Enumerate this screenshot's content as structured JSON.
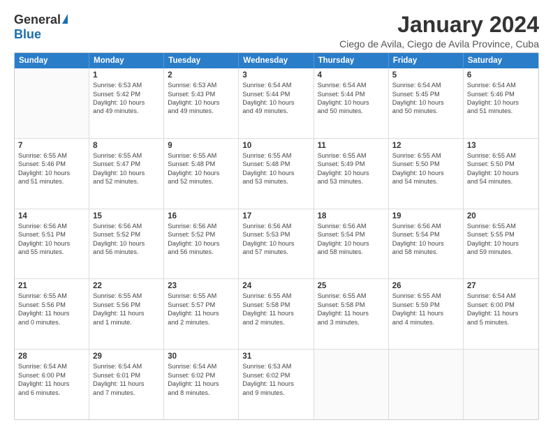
{
  "logo": {
    "general": "General",
    "blue": "Blue"
  },
  "title": "January 2024",
  "subtitle": "Ciego de Avila, Ciego de Avila Province, Cuba",
  "header_days": [
    "Sunday",
    "Monday",
    "Tuesday",
    "Wednesday",
    "Thursday",
    "Friday",
    "Saturday"
  ],
  "weeks": [
    [
      {
        "day": "",
        "info": ""
      },
      {
        "day": "1",
        "info": "Sunrise: 6:53 AM\nSunset: 5:42 PM\nDaylight: 10 hours\nand 49 minutes."
      },
      {
        "day": "2",
        "info": "Sunrise: 6:53 AM\nSunset: 5:43 PM\nDaylight: 10 hours\nand 49 minutes."
      },
      {
        "day": "3",
        "info": "Sunrise: 6:54 AM\nSunset: 5:44 PM\nDaylight: 10 hours\nand 49 minutes."
      },
      {
        "day": "4",
        "info": "Sunrise: 6:54 AM\nSunset: 5:44 PM\nDaylight: 10 hours\nand 50 minutes."
      },
      {
        "day": "5",
        "info": "Sunrise: 6:54 AM\nSunset: 5:45 PM\nDaylight: 10 hours\nand 50 minutes."
      },
      {
        "day": "6",
        "info": "Sunrise: 6:54 AM\nSunset: 5:46 PM\nDaylight: 10 hours\nand 51 minutes."
      }
    ],
    [
      {
        "day": "7",
        "info": "Sunrise: 6:55 AM\nSunset: 5:46 PM\nDaylight: 10 hours\nand 51 minutes."
      },
      {
        "day": "8",
        "info": "Sunrise: 6:55 AM\nSunset: 5:47 PM\nDaylight: 10 hours\nand 52 minutes."
      },
      {
        "day": "9",
        "info": "Sunrise: 6:55 AM\nSunset: 5:48 PM\nDaylight: 10 hours\nand 52 minutes."
      },
      {
        "day": "10",
        "info": "Sunrise: 6:55 AM\nSunset: 5:48 PM\nDaylight: 10 hours\nand 53 minutes."
      },
      {
        "day": "11",
        "info": "Sunrise: 6:55 AM\nSunset: 5:49 PM\nDaylight: 10 hours\nand 53 minutes."
      },
      {
        "day": "12",
        "info": "Sunrise: 6:55 AM\nSunset: 5:50 PM\nDaylight: 10 hours\nand 54 minutes."
      },
      {
        "day": "13",
        "info": "Sunrise: 6:55 AM\nSunset: 5:50 PM\nDaylight: 10 hours\nand 54 minutes."
      }
    ],
    [
      {
        "day": "14",
        "info": "Sunrise: 6:56 AM\nSunset: 5:51 PM\nDaylight: 10 hours\nand 55 minutes."
      },
      {
        "day": "15",
        "info": "Sunrise: 6:56 AM\nSunset: 5:52 PM\nDaylight: 10 hours\nand 56 minutes."
      },
      {
        "day": "16",
        "info": "Sunrise: 6:56 AM\nSunset: 5:52 PM\nDaylight: 10 hours\nand 56 minutes."
      },
      {
        "day": "17",
        "info": "Sunrise: 6:56 AM\nSunset: 5:53 PM\nDaylight: 10 hours\nand 57 minutes."
      },
      {
        "day": "18",
        "info": "Sunrise: 6:56 AM\nSunset: 5:54 PM\nDaylight: 10 hours\nand 58 minutes."
      },
      {
        "day": "19",
        "info": "Sunrise: 6:56 AM\nSunset: 5:54 PM\nDaylight: 10 hours\nand 58 minutes."
      },
      {
        "day": "20",
        "info": "Sunrise: 6:55 AM\nSunset: 5:55 PM\nDaylight: 10 hours\nand 59 minutes."
      }
    ],
    [
      {
        "day": "21",
        "info": "Sunrise: 6:55 AM\nSunset: 5:56 PM\nDaylight: 11 hours\nand 0 minutes."
      },
      {
        "day": "22",
        "info": "Sunrise: 6:55 AM\nSunset: 5:56 PM\nDaylight: 11 hours\nand 1 minute."
      },
      {
        "day": "23",
        "info": "Sunrise: 6:55 AM\nSunset: 5:57 PM\nDaylight: 11 hours\nand 2 minutes."
      },
      {
        "day": "24",
        "info": "Sunrise: 6:55 AM\nSunset: 5:58 PM\nDaylight: 11 hours\nand 2 minutes."
      },
      {
        "day": "25",
        "info": "Sunrise: 6:55 AM\nSunset: 5:58 PM\nDaylight: 11 hours\nand 3 minutes."
      },
      {
        "day": "26",
        "info": "Sunrise: 6:55 AM\nSunset: 5:59 PM\nDaylight: 11 hours\nand 4 minutes."
      },
      {
        "day": "27",
        "info": "Sunrise: 6:54 AM\nSunset: 6:00 PM\nDaylight: 11 hours\nand 5 minutes."
      }
    ],
    [
      {
        "day": "28",
        "info": "Sunrise: 6:54 AM\nSunset: 6:00 PM\nDaylight: 11 hours\nand 6 minutes."
      },
      {
        "day": "29",
        "info": "Sunrise: 6:54 AM\nSunset: 6:01 PM\nDaylight: 11 hours\nand 7 minutes."
      },
      {
        "day": "30",
        "info": "Sunrise: 6:54 AM\nSunset: 6:02 PM\nDaylight: 11 hours\nand 8 minutes."
      },
      {
        "day": "31",
        "info": "Sunrise: 6:53 AM\nSunset: 6:02 PM\nDaylight: 11 hours\nand 9 minutes."
      },
      {
        "day": "",
        "info": ""
      },
      {
        "day": "",
        "info": ""
      },
      {
        "day": "",
        "info": ""
      }
    ]
  ]
}
